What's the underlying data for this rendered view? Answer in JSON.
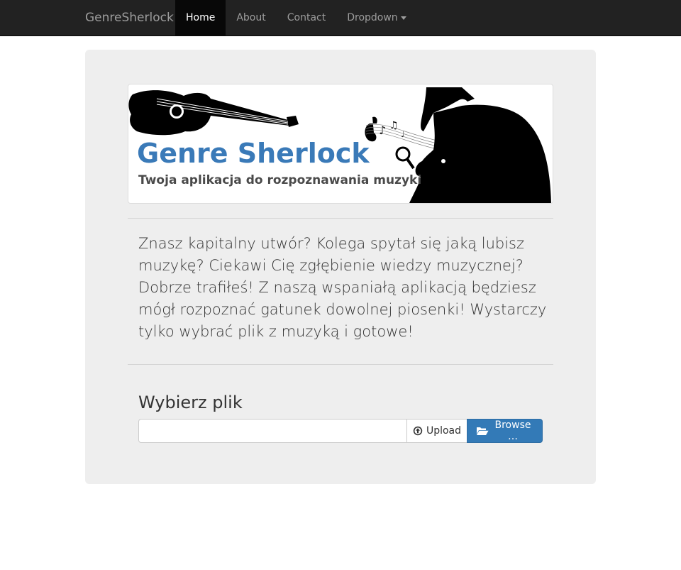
{
  "navbar": {
    "brand": "GenreSherlock",
    "items": [
      {
        "label": "Home",
        "active": true
      },
      {
        "label": "About",
        "active": false
      },
      {
        "label": "Contact",
        "active": false
      },
      {
        "label": "Dropdown",
        "active": false,
        "has_caret": true
      }
    ]
  },
  "banner": {
    "title": "Genre Sherlock",
    "subtitle": "Twoja aplikacja do rozpoznawania muzyki",
    "title_color": "#3a7ab8"
  },
  "main": {
    "lead": "Znasz kapitalny utwór? Kolega spytał się jaką lubisz muzykę? Ciekawi Cię zgłębienie wiedzy muzycznej? Dobrze trafiłeś! Z naszą wspaniałą aplikacją będziesz mógł rozpoznać gatunek dowolnej piosenki! Wystarczy tylko wybrać plik z muzyką i gotowe!",
    "file_label": "Wybierz plik",
    "file_input_value": "",
    "upload_label": "Upload",
    "browse_label": "Browse …"
  },
  "colors": {
    "navbar_bg": "#222222",
    "jumbotron_bg": "#eeeeee",
    "primary": "#337ab7"
  },
  "icons": {
    "upload": "circle-arrow-up-icon",
    "browse": "folder-open-icon",
    "dropdown": "caret-down-icon"
  }
}
